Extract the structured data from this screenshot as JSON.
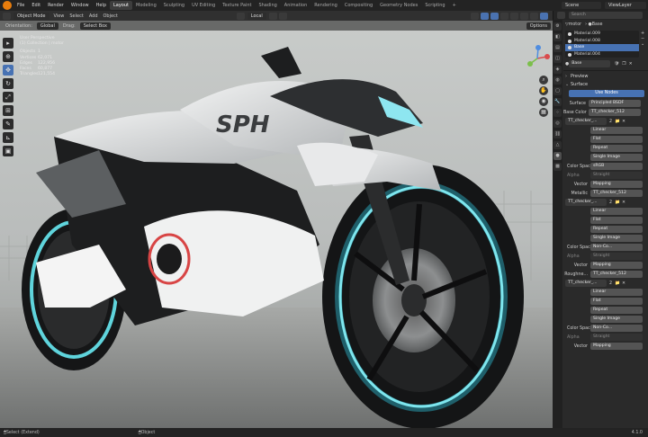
{
  "app": {
    "menus": [
      "File",
      "Edit",
      "Render",
      "Window",
      "Help"
    ],
    "workspaces": [
      "Layout",
      "Modeling",
      "Sculpting",
      "UV Editing",
      "Texture Paint",
      "Shading",
      "Animation",
      "Rendering",
      "Compositing",
      "Geometry Nodes",
      "Scripting"
    ],
    "active_workspace": "Layout",
    "scene_label": "Scene",
    "viewlayer_label": "ViewLayer"
  },
  "viewport": {
    "mode": "Object Mode",
    "view_menu": "View",
    "select_menu": "Select",
    "add_menu": "Add",
    "object_menu": "Object",
    "transform_orientation": "Local",
    "orientation_label": "Orientation:",
    "orientation_value": "Global",
    "drag_label": "Drag:",
    "drag_value": "Select Box",
    "options": "Options",
    "stats": {
      "title": "User Perspective",
      "collection": "(1) Collection | motor",
      "rows": [
        {
          "k": "Objects",
          "v": "1"
        },
        {
          "k": "Vertices",
          "v": "62,071"
        },
        {
          "k": "Edges",
          "v": "122,956"
        },
        {
          "k": "Faces",
          "v": "60,877"
        },
        {
          "k": "Triangles",
          "v": "121,554"
        }
      ]
    }
  },
  "panel": {
    "search_placeholder": "Search",
    "breadcrumb_object": "motor",
    "breadcrumb_material": "Base",
    "slots": [
      "Material.009",
      "Material.008",
      "Base",
      "Material.004"
    ],
    "selected_slot": "Base",
    "material_name": "Base",
    "preview": "Preview",
    "surface": "Surface",
    "use_nodes": "Use Nodes",
    "surface_label": "Surface",
    "surface_value": "Principled BSDF",
    "base_color_label": "Base Color",
    "tex_name": "TT_checker_512",
    "tex_short": "TT_checker_...",
    "tex_users": "2",
    "linear": "Linear",
    "flat": "Flat",
    "repeat": "Repeat",
    "single_image": "Single Image",
    "color_space_label": "Color Space",
    "color_space_srgb": "sRGB",
    "color_space_non": "Non-Co...",
    "alpha_label": "Alpha",
    "alpha_value": "Straight",
    "vector_label": "Vector",
    "vector_value": "Mapping",
    "metallic_label": "Metallic",
    "roughness_label": "Roughne..."
  },
  "status": {
    "left": "Select (Extend)",
    "mid": "Object",
    "right": "4.1.0"
  },
  "colors": {
    "accent": "#4772b3",
    "logo": "#e87d0d"
  }
}
